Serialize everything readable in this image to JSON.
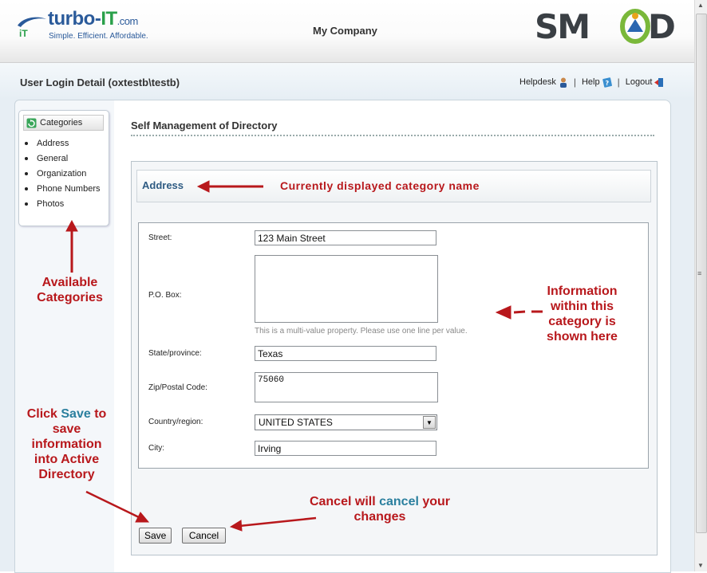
{
  "header": {
    "logo_turbo": "turbo-",
    "logo_it": "IT",
    "logo_com": ".com",
    "logo_tagline": "Simple.  Efficient.  Affordable.",
    "company": "My Company",
    "smod_logo_text": "SMOD"
  },
  "subheader": {
    "user_login": "User Login Detail (oxtestb\\testb)",
    "links": {
      "helpdesk": "Helpdesk",
      "help": "Help",
      "logout": "Logout"
    },
    "separator": "|"
  },
  "sidebar": {
    "title": "Categories",
    "items": [
      {
        "label": "Address"
      },
      {
        "label": "General"
      },
      {
        "label": "Organization"
      },
      {
        "label": "Phone Numbers"
      },
      {
        "label": "Photos"
      }
    ]
  },
  "main": {
    "heading": "Self Management of Directory",
    "category_title": "Address",
    "fields": {
      "street": {
        "label": "Street:",
        "value": "123 Main Street"
      },
      "po_box": {
        "label": "P.O. Box:",
        "value": "",
        "hint": "This is a multi-value property. Please use one line per value."
      },
      "state": {
        "label": "State/province:",
        "value": "Texas"
      },
      "zip": {
        "label": "Zip/Postal Code:",
        "value": "75060"
      },
      "country": {
        "label": "Country/region:",
        "value": "UNITED STATES"
      },
      "city": {
        "label": "City:",
        "value": "Irving"
      }
    },
    "buttons": {
      "save": "Save",
      "cancel": "Cancel"
    }
  },
  "annotations": {
    "category_name": "Currently displayed category name",
    "available_1": "Available",
    "available_2": "Categories",
    "info_1": "Information",
    "info_2": "within this",
    "info_3": "category is",
    "info_4": "shown here",
    "save_click": "Click ",
    "save_word": "Save",
    "save_to": " to",
    "save_2": "save",
    "save_3": "information",
    "save_4": "into Active",
    "save_5": "Directory",
    "cancel_1": "Cancel will ",
    "cancel_word": "cancel",
    "cancel_2": " your",
    "cancel_3": "changes"
  },
  "colors": {
    "annotation_red": "#b8181c",
    "annotation_highlight": "#2a7f9e",
    "category_title_blue": "#2f5b83",
    "logo_blue": "#2a5a9a",
    "logo_green": "#2aa04a"
  },
  "icons": [
    "turbo-it-logo-icon",
    "smod-logo-icon",
    "helpdesk-icon",
    "help-icon",
    "logout-icon",
    "categories-refresh-icon",
    "dropdown-arrow-icon"
  ]
}
